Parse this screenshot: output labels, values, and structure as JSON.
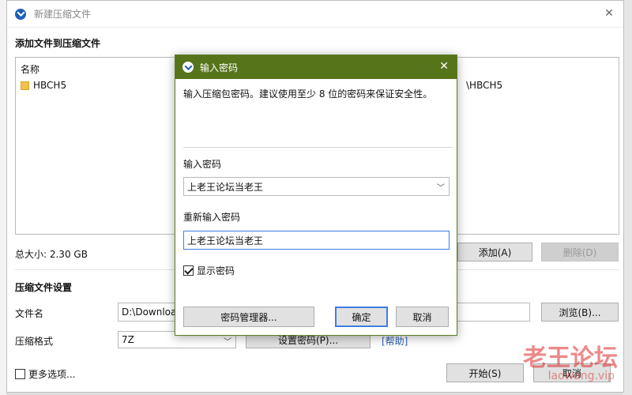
{
  "window": {
    "title": "新建压缩文件"
  },
  "add_section": {
    "title": "添加文件到压缩文件"
  },
  "file_list": {
    "column_name": "名称",
    "items": [
      {
        "name": "HBCH5",
        "path_fragment": "\\HBCH5"
      }
    ]
  },
  "summary": {
    "total_size": "总大小: 2.30 GB"
  },
  "buttons": {
    "add": "添加(A)",
    "delete": "删除(D)",
    "browse": "浏览(B)...",
    "start": "开始(S)",
    "cancel": "取消",
    "set_password": "设置密码(P)...",
    "help": "[帮助]"
  },
  "settings": {
    "title": "压缩文件设置",
    "filename_label": "文件名",
    "filename_value": "D:\\Downloa",
    "format_label": "压缩格式",
    "format_value": "7Z",
    "more_options": "更多选项..."
  },
  "password_dialog": {
    "title": "输入密码",
    "description": "输入压缩包密码。建议使用至少 8 位的密码来保证安全性。",
    "password_label": "输入密码",
    "password_value": "上老王论坛当老王",
    "reenter_label": "重新输入密码",
    "reenter_value": "上老王论坛当老王",
    "show_password": "显示密码",
    "show_password_checked": true,
    "manager_button": "密码管理器...",
    "ok_button": "确定",
    "cancel_button": "取消"
  },
  "watermark": {
    "text": "老王论坛",
    "subtext": "laowang.vip"
  },
  "colors": {
    "dialog_title_bg": "#56741a",
    "focus_border": "#3e7ee0",
    "link": "#2a5db0"
  }
}
